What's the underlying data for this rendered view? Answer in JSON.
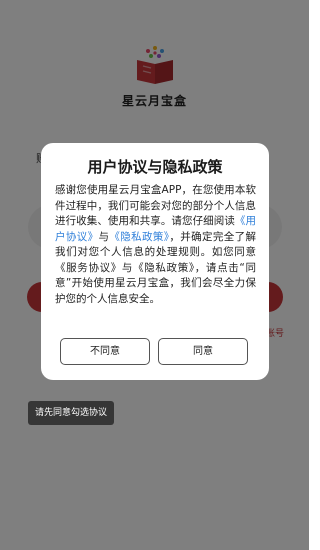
{
  "app": {
    "name": "星云月宝盒"
  },
  "background": {
    "left_fragment": "账",
    "right_fragment": "账号"
  },
  "toast": {
    "text": "请先同意勾选协议"
  },
  "dialog": {
    "title": "用户协议与隐私政策",
    "body": {
      "part1": "感谢您使用星云月宝盒APP，在您使用本软件过程中，我们可能会对您的部分个人信息进行收集、使用和共享。请您仔细阅读",
      "link_user_agreement": "《用户协议》",
      "part2": "与",
      "link_privacy_policy": "《隐私政策》",
      "part3": "，并确定完全了解我们对您个人信息的处理规则。如您同意《服务协议》与《隐私政策》，请点击“同意”开始使用星云月宝盒，我们会尽全力保护您的个人信息安全。"
    },
    "disagree_label": "不同意",
    "agree_label": "同意"
  },
  "colors": {
    "brand_red": "#c8373b",
    "link_blue": "#2f7fd9"
  }
}
